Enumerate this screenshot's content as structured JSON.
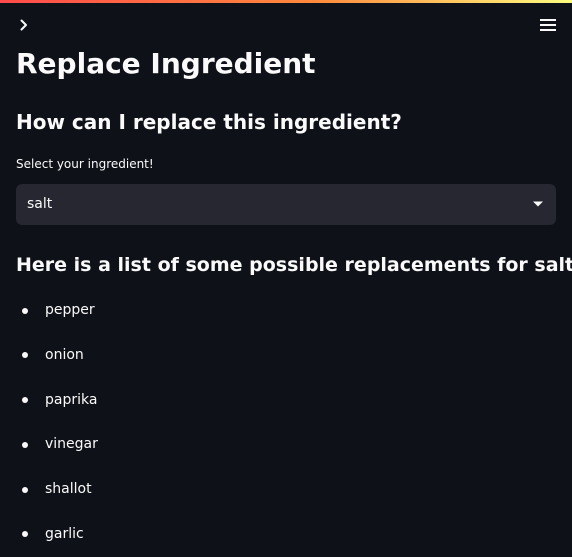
{
  "app": {
    "title": "Replace Ingredient",
    "accent_colors": [
      "#ff4b4b",
      "#fffd80"
    ],
    "background": "#0e1117",
    "widget_background": "#262730"
  },
  "toolbar": {
    "sidebar_toggle_icon": "chevron-right-icon",
    "menu_icon": "hamburger-menu-icon"
  },
  "main": {
    "subheader": "How can I replace this ingredient?",
    "select": {
      "label": "Select your ingredient!",
      "value": "salt"
    },
    "list_header": "Here is a list of some possible replacements for salt:",
    "replacements": [
      "pepper",
      "onion",
      "paprika",
      "vinegar",
      "shallot",
      "garlic"
    ]
  }
}
